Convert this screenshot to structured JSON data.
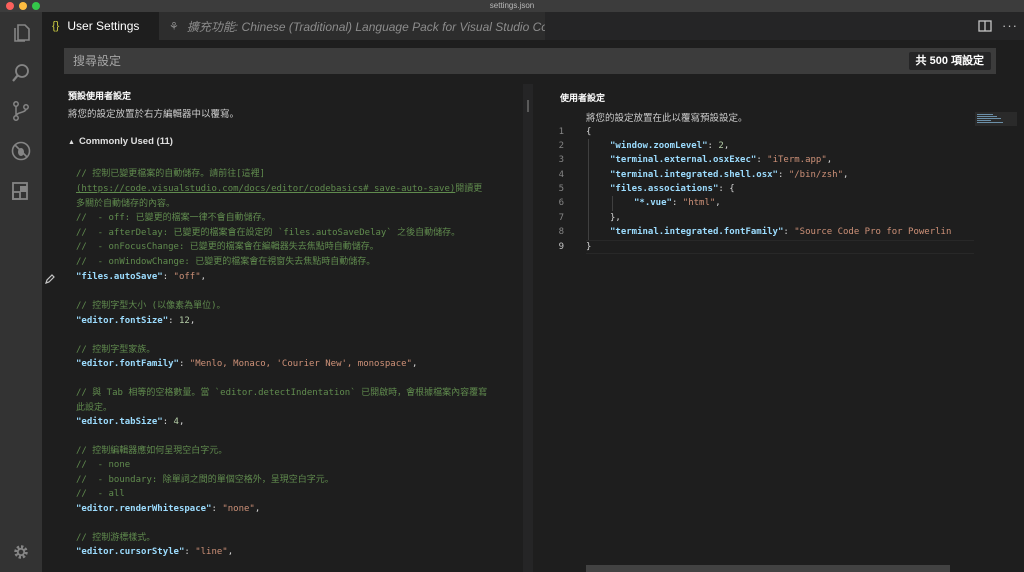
{
  "window": {
    "title": "settings.json"
  },
  "colors": {
    "close": "#fc605c",
    "minimize": "#fdbc40",
    "maximize": "#34c84a",
    "accent": "#cbcb41"
  },
  "activity_bar": {
    "icons": [
      "files-icon",
      "search-icon",
      "source-control-icon",
      "debug-icon",
      "extensions-icon",
      "gear-icon"
    ]
  },
  "tabs": [
    {
      "label": "User Settings",
      "icon": "{}",
      "active": true
    },
    {
      "label": "擴充功能: Chinese (Traditional) Language Pack for Visual Studio Code",
      "active": false
    }
  ],
  "search": {
    "placeholder": "搜尋設定",
    "count": "共 500 項設定"
  },
  "default_pane": {
    "title": "預設使用者設定",
    "description": "將您的設定放置於右方編輯器中以覆寫。",
    "group": "Commonly Used (11)"
  },
  "user_pane": {
    "title": "使用者設定",
    "description": "將您的設定放置在此以覆寫預設設定。"
  },
  "default_settings": {
    "l1": "// 控制已變更檔案的自動儲存。請前往[這裡]",
    "l2_link": "(https://code.visualstudio.com/docs/editor/codebasics#_save-auto-save)",
    "l2_rest": "閱讀更",
    "l3": "多關於自動儲存的內容。",
    "l4": "//  - off: 已變更的檔案一律不會自動儲存。",
    "l5": "//  - afterDelay: 已變更的檔案會在設定的 `files.autoSaveDelay` 之後自動儲存。",
    "l6": "//  - onFocusChange: 已變更的檔案會在編輯器失去焦點時自動儲存。",
    "l7": "//  - onWindowChange: 已變更的檔案會在視窗失去焦點時自動儲存。",
    "autosave_key": "\"files.autoSave\"",
    "autosave_val": "\"off\"",
    "fontsize_comment": "// 控制字型大小 (以像素為單位)。",
    "fontsize_key": "\"editor.fontSize\"",
    "fontsize_val": "12",
    "fontfamily_comment": "// 控制字型家族。",
    "fontfamily_key": "\"editor.fontFamily\"",
    "fontfamily_val": "\"Menlo, Monaco, 'Courier New', monospace\"",
    "tabsize_comment1": "// 與 Tab 相等的空格數量。當 `editor.detectIndentation` 已開啟時，會根據檔案內容覆寫",
    "tabsize_comment2": "此設定。",
    "tabsize_key": "\"editor.tabSize\"",
    "tabsize_val": "4",
    "ws_comment": "// 控制編輯器應如何呈現空白字元。",
    "ws_opt1": "//  - none",
    "ws_opt2": "//  - boundary: 除單詞之間的單個空格外，呈現空白字元。",
    "ws_opt3": "//  - all",
    "ws_key": "\"editor.renderWhitespace\"",
    "ws_val": "\"none\"",
    "cursor_comment": "// 控制游標樣式。",
    "cursor_key": "\"editor.cursorStyle\"",
    "cursor_val": "\"line\""
  },
  "user_settings": {
    "line_numbers": [
      "1",
      "2",
      "3",
      "4",
      "5",
      "6",
      "7",
      "8",
      "9"
    ],
    "open_brace": "{",
    "zoom_key": "\"window.zoomLevel\"",
    "zoom_val": "2",
    "ext_key": "\"terminal.external.osxExec\"",
    "ext_val": "\"iTerm.app\"",
    "shell_key": "\"terminal.integrated.shell.osx\"",
    "shell_val": "\"/bin/zsh\"",
    "assoc_key": "\"files.associations\"",
    "vue_key": "\"*.vue\"",
    "vue_val": "\"html\"",
    "assoc_close": "},",
    "font_key": "\"terminal.integrated.fontFamily\"",
    "font_val": "\"Source Code Pro for Powerlin",
    "close_brace": "}"
  }
}
